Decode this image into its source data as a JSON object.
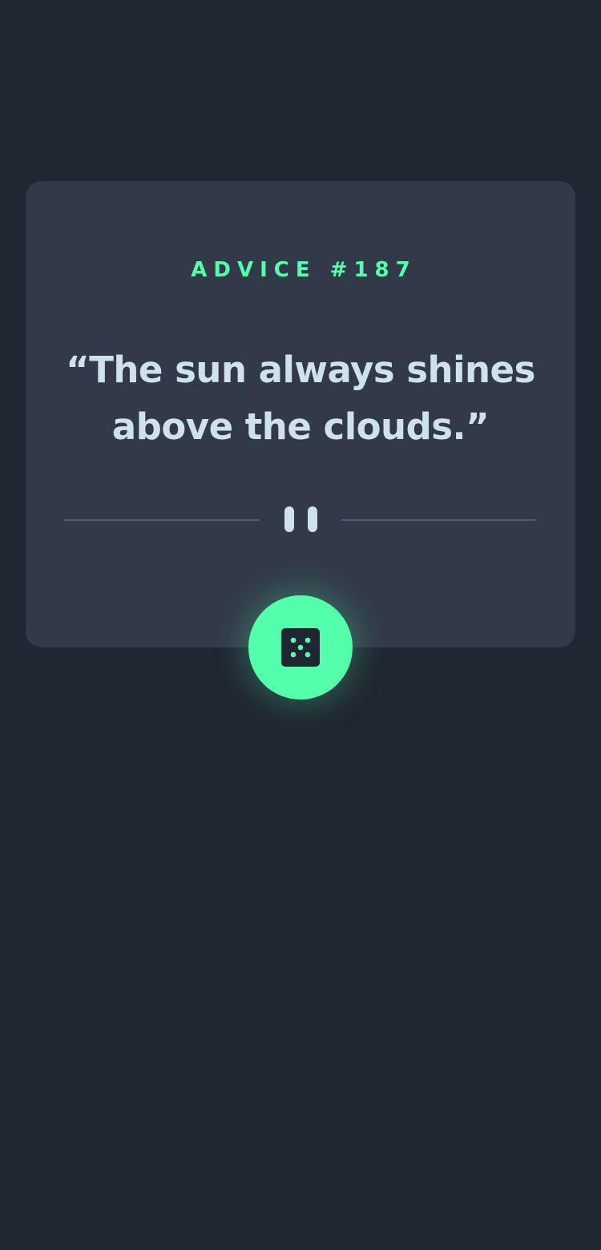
{
  "advice": {
    "id_label": "ADVICE #187",
    "quote": "“The sun always shines above the clouds.”"
  },
  "icons": {
    "divider": "pause-icon",
    "button": "dice-icon"
  },
  "colors": {
    "background": "#202632",
    "card": "#323a49",
    "accent": "#53ffaa",
    "text": "#cee3e9",
    "divider": "#4f5d74"
  }
}
